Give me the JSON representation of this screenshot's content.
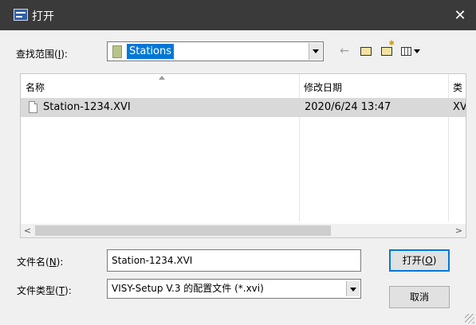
{
  "window": {
    "title": "打开",
    "close_glyph": "✕"
  },
  "look_in": {
    "label_prefix": "查找范围(",
    "label_key": "I",
    "label_suffix": "):",
    "value": "Stations"
  },
  "list": {
    "columns": [
      "名称",
      "修改日期",
      "类"
    ],
    "rows": [
      {
        "name": "Station-1234.XVI",
        "modified": "2020/6/24 13:47",
        "type": "XV"
      }
    ]
  },
  "file_name": {
    "label_prefix": "文件名(",
    "label_key": "N",
    "label_suffix": "):",
    "value": "Station-1234.XVI"
  },
  "file_type": {
    "label_prefix": "文件类型(",
    "label_key": "T",
    "label_suffix": "):",
    "value": "VISY-Setup V.3 的配置文件 (*.xvi)"
  },
  "buttons": {
    "open_prefix": "打开(",
    "open_key": "O",
    "open_suffix": ")",
    "cancel": "取消"
  },
  "icons": {
    "back": "back-arrow-icon",
    "up": "up-folder-icon",
    "new": "new-folder-icon",
    "view": "view-menu-icon"
  }
}
